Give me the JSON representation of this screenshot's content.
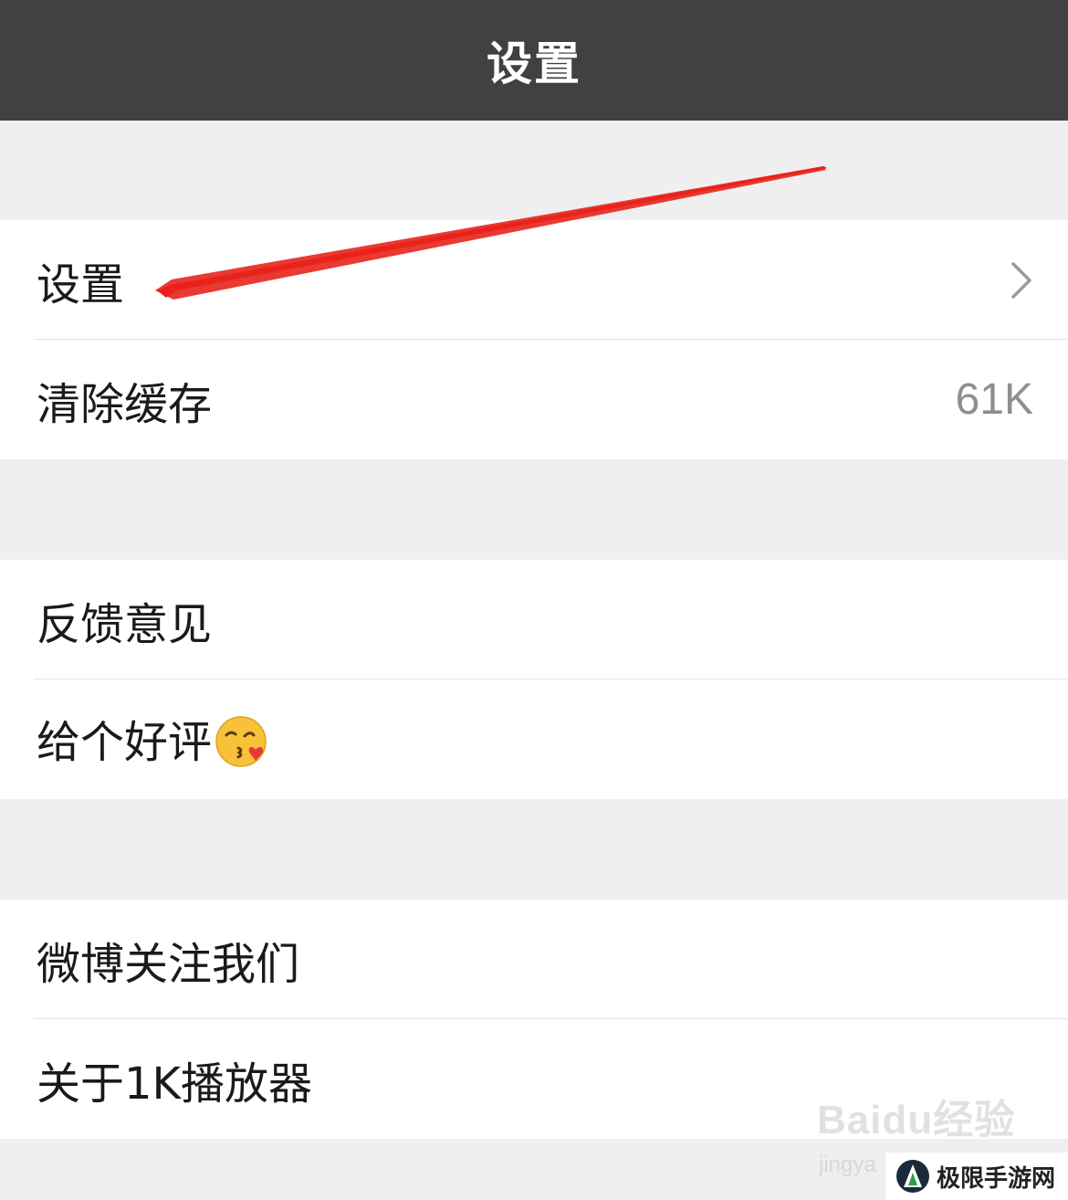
{
  "header": {
    "title": "设置"
  },
  "groups": [
    {
      "items": [
        {
          "label": "设置",
          "accessory": "chevron-right-icon"
        },
        {
          "label": "清除缓存",
          "value": "61K"
        }
      ]
    },
    {
      "items": [
        {
          "label": "反馈意见"
        },
        {
          "label": "给个好评",
          "icon": "kissing-face-emoji-icon"
        }
      ]
    },
    {
      "items": [
        {
          "label": "微博关注我们"
        },
        {
          "label": "关于1K播放器"
        }
      ]
    }
  ],
  "annotation": {
    "icon": "red-arrow-icon",
    "color": "#e8231c"
  },
  "watermark": {
    "brand": "Baidu经验",
    "sub": "jingya"
  },
  "site_badge": {
    "name": "极限手游网"
  },
  "colors": {
    "navbar": "#414141",
    "background": "#efefef",
    "value_text": "#8e8e8e"
  }
}
